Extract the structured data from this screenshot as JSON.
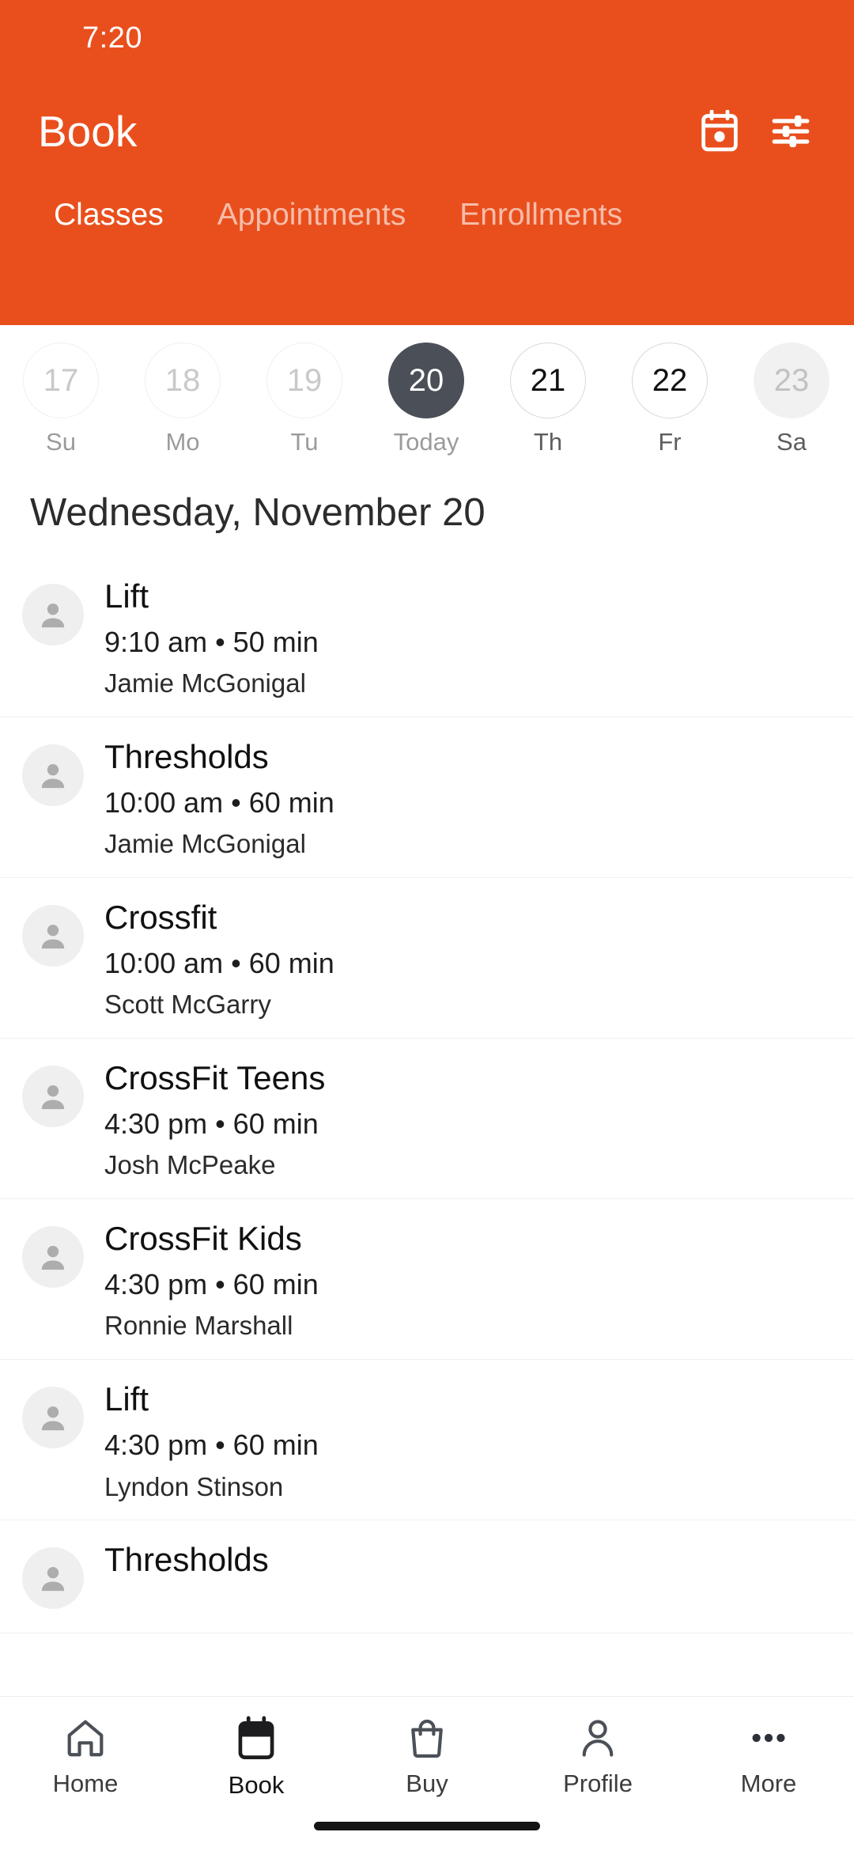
{
  "theme": {
    "accent": "#e94f1d",
    "today_circle": "#4a4f58",
    "text_primary": "#101010",
    "muted": "#9b9b9b"
  },
  "status_bar": {
    "time": "7:20"
  },
  "app_bar": {
    "title": "Book",
    "actions": [
      {
        "icon": "calendar-icon",
        "label": "Calendar"
      },
      {
        "icon": "filter-sliders-icon",
        "label": "Filters"
      }
    ]
  },
  "tabs": [
    {
      "label": "Classes",
      "active": true
    },
    {
      "label": "Appointments",
      "active": false
    },
    {
      "label": "Enrollments",
      "active": false
    }
  ],
  "date_strip": [
    {
      "day": "17",
      "weekday": "Su",
      "state": "past"
    },
    {
      "day": "18",
      "weekday": "Mo",
      "state": "past"
    },
    {
      "day": "19",
      "weekday": "Tu",
      "state": "past"
    },
    {
      "day": "20",
      "weekday": "Today",
      "state": "today"
    },
    {
      "day": "21",
      "weekday": "Th",
      "state": "future"
    },
    {
      "day": "22",
      "weekday": "Fr",
      "state": "future"
    },
    {
      "day": "23",
      "weekday": "Sa",
      "state": "pressed"
    }
  ],
  "date_heading": "Wednesday, November 20",
  "classes": [
    {
      "name": "Lift",
      "schedule": "9:10 am • 50 min",
      "instructor": "Jamie McGonigal"
    },
    {
      "name": "Thresholds",
      "schedule": "10:00 am • 60 min",
      "instructor": "Jamie McGonigal"
    },
    {
      "name": "Crossfit",
      "schedule": "10:00 am • 60 min",
      "instructor": "Scott McGarry"
    },
    {
      "name": "CrossFit Teens",
      "schedule": "4:30 pm • 60 min",
      "instructor": "Josh McPeake"
    },
    {
      "name": "CrossFit Kids",
      "schedule": "4:30 pm • 60 min",
      "instructor": "Ronnie Marshall"
    },
    {
      "name": "Lift",
      "schedule": "4:30 pm • 60 min",
      "instructor": "Lyndon Stinson"
    },
    {
      "name": "Thresholds",
      "schedule": "",
      "instructor": ""
    }
  ],
  "bottom_nav": [
    {
      "label": "Home",
      "icon": "home-icon",
      "active": false
    },
    {
      "label": "Book",
      "icon": "calendar-icon",
      "active": true
    },
    {
      "label": "Buy",
      "icon": "bag-icon",
      "active": false
    },
    {
      "label": "Profile",
      "icon": "person-icon",
      "active": false
    },
    {
      "label": "More",
      "icon": "dots-icon",
      "active": false
    }
  ]
}
